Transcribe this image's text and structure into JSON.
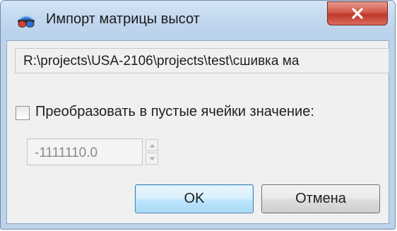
{
  "window": {
    "title": "Импорт матрицы высот",
    "app_icon": "stereo-glasses-icon",
    "close_icon": "close-icon"
  },
  "path_field": {
    "value": "R:\\projects\\USA-2106\\projects\\test\\сшивка ма"
  },
  "convert_checkbox": {
    "checked": false,
    "label": "Преобразовать в пустые ячейки значение:"
  },
  "value_input": {
    "value": "-1111110.0",
    "enabled": false
  },
  "buttons": {
    "ok_label": "OK",
    "cancel_label": "Отмена"
  },
  "colors": {
    "close_button": "#c0392b",
    "ok_border": "#3c7fb1",
    "window_frame": "#bcd3ea",
    "client_background": "#f0f0f0"
  }
}
